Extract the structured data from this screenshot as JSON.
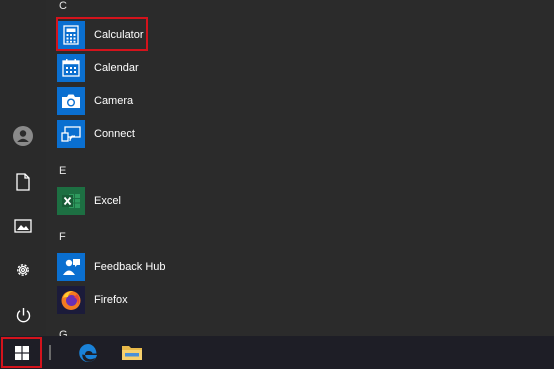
{
  "left_rail": {
    "icons": [
      "user-avatar-icon",
      "document-icon",
      "pictures-icon",
      "settings-gear-icon",
      "power-icon"
    ]
  },
  "app_list": {
    "sections": [
      {
        "letter": "C",
        "apps": [
          {
            "label": "Calculator",
            "icon": "calculator-icon",
            "tile_color": "#0a6fd0",
            "highlighted": true
          },
          {
            "label": "Calendar",
            "icon": "calendar-icon",
            "tile_color": "#0a6fd0"
          },
          {
            "label": "Camera",
            "icon": "camera-icon",
            "tile_color": "#0a6fd0"
          },
          {
            "label": "Connect",
            "icon": "connect-icon",
            "tile_color": "#0a6fd0"
          }
        ]
      },
      {
        "letter": "E",
        "apps": [
          {
            "label": "Excel",
            "icon": "excel-icon",
            "tile_color": "#1d6f42"
          }
        ]
      },
      {
        "letter": "F",
        "apps": [
          {
            "label": "Feedback Hub",
            "icon": "feedback-hub-icon",
            "tile_color": "#0a6fd0"
          },
          {
            "label": "Firefox",
            "icon": "firefox-icon",
            "tile_color": "#1b1b3a"
          }
        ]
      },
      {
        "letter": "G",
        "apps": []
      }
    ]
  },
  "taskbar": {
    "start_icon": "windows-logo-icon",
    "pinned": [
      "edge-icon",
      "file-explorer-icon"
    ]
  },
  "colors": {
    "menu_background": "#2b2b2b",
    "taskbar_background": "#1e1e26",
    "accent_blue": "#0a6fd0",
    "highlight_red": "#d4131c"
  }
}
